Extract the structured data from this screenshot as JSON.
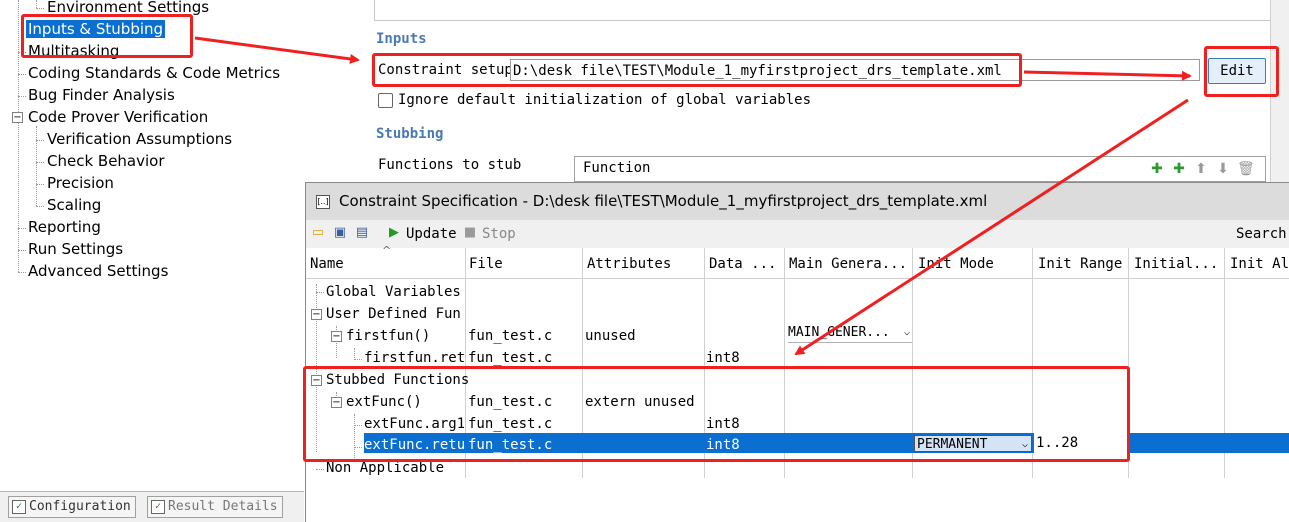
{
  "nav": {
    "items": [
      "Environment Settings",
      "Inputs & Stubbing",
      "Multitasking",
      "Coding Standards & Code Metrics",
      "Bug Finder Analysis",
      "Code Prover Verification",
      "Verification Assumptions",
      "Check Behavior",
      "Precision",
      "Scaling",
      "Reporting",
      "Run Settings",
      "Advanced Settings"
    ],
    "selected": "Inputs & Stubbing"
  },
  "bottom_tabs": [
    "Configuration",
    "Result Details"
  ],
  "config": {
    "inputs_title": "Inputs",
    "constraint_label": "Constraint setup",
    "constraint_value": "D:\\desk file\\TEST\\Module_1_myfirstproject_drs_template.xml",
    "edit_label": "Edit",
    "ignore_label": "Ignore default initialization of global variables",
    "stubbing_title": "Stubbing",
    "functions_to_stub_label": "Functions to stub",
    "function_column": "Function"
  },
  "dialog": {
    "title": "Constraint Specification - D:\\desk file\\TEST\\Module_1_myfirstproject_drs_template.xml",
    "toolbar": {
      "update": "Update",
      "stop": "Stop",
      "search": "Search"
    },
    "columns": [
      "Name",
      "File",
      "Attributes",
      "Data ...",
      "Main Genera...",
      "Init Mode",
      "Init Range",
      "Initial...",
      "Init All"
    ],
    "rows": {
      "global_variables": "Global Variables",
      "user_defined": "User Defined Fun..",
      "firstfun": {
        "name": "firstfun()",
        "file": "fun_test.c",
        "attributes": "unused",
        "main_gen": "MAIN_GENER..."
      },
      "firstfun_ret": {
        "name": "firstfun.retu",
        "file": "fun_test.c",
        "data": "int8"
      },
      "stubbed": "Stubbed Functions",
      "extfunc": {
        "name": "extFunc()",
        "file": "fun_test.c",
        "attributes": "extern unused"
      },
      "extfunc_arg": {
        "name": "extFunc.arg1",
        "file": "fun_test.c",
        "data": "int8"
      },
      "extfunc_ret": {
        "name": "extFunc.retu",
        "file": "fun_test.c",
        "data": "int8",
        "init_mode": "PERMANENT",
        "init_range": "1..28"
      },
      "non_applicable": "Non Applicable"
    }
  },
  "colors": {
    "annotation": "#f02020",
    "selection": "#0a6fd1",
    "section_title": "#4a7ab5"
  }
}
